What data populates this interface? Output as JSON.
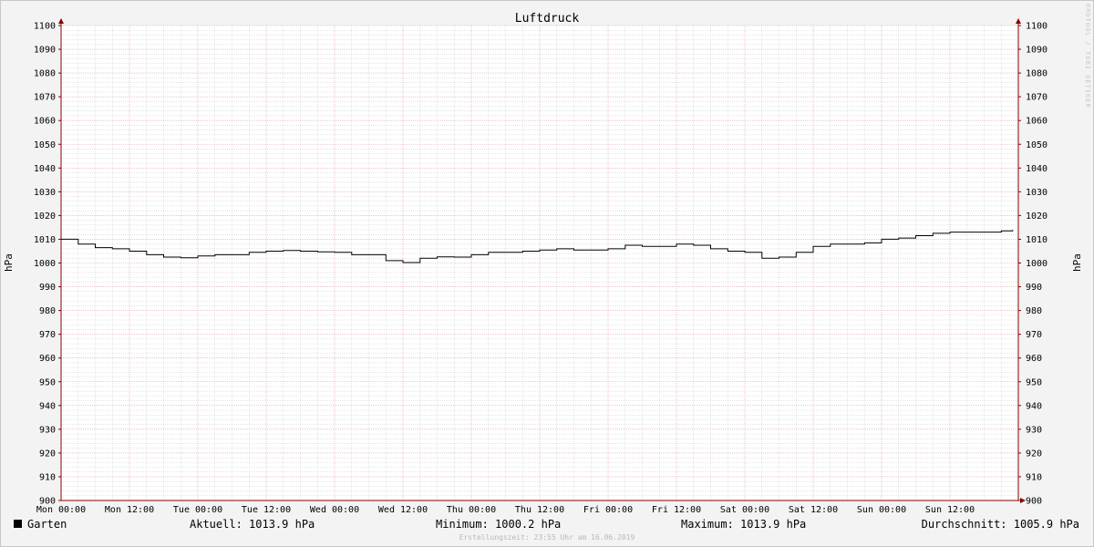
{
  "chart_data": {
    "type": "line",
    "title": "Luftdruck",
    "ylabel": "hPa",
    "ylim": [
      900,
      1100
    ],
    "yticks": [
      900,
      910,
      920,
      930,
      940,
      950,
      960,
      970,
      980,
      990,
      1000,
      1010,
      1020,
      1030,
      1040,
      1050,
      1060,
      1070,
      1080,
      1090,
      1100
    ],
    "x_tick_labels": [
      "Mon 00:00",
      "Mon 12:00",
      "Tue 00:00",
      "Tue 12:00",
      "Wed 00:00",
      "Wed 12:00",
      "Thu 00:00",
      "Thu 12:00",
      "Fri 00:00",
      "Fri 12:00",
      "Sat 00:00",
      "Sat 12:00",
      "Sun 00:00",
      "Sun 12:00"
    ],
    "x_unit": "hours since Mon 00:00",
    "xlim": [
      0,
      168
    ],
    "grid": true,
    "series": [
      {
        "name": "Garten",
        "color": "#000000",
        "x": [
          0,
          3,
          6,
          9,
          12,
          15,
          18,
          21,
          24,
          27,
          30,
          33,
          36,
          39,
          42,
          45,
          48,
          51,
          54,
          57,
          60,
          63,
          66,
          69,
          72,
          75,
          78,
          81,
          84,
          87,
          90,
          93,
          96,
          99,
          102,
          105,
          108,
          111,
          114,
          117,
          120,
          123,
          126,
          129,
          132,
          135,
          138,
          141,
          144,
          147,
          150,
          153,
          156,
          159,
          162,
          165,
          167
        ],
        "values": [
          1010,
          1008,
          1006.5,
          1006,
          1005,
          1003.5,
          1002.5,
          1002.2,
          1003,
          1003.5,
          1003.5,
          1004.5,
          1005,
          1005.3,
          1005,
          1004.7,
          1004.5,
          1003.5,
          1003.5,
          1001,
          1000.2,
          1002,
          1002.6,
          1002.5,
          1003.5,
          1004.5,
          1004.5,
          1005,
          1005.5,
          1006,
          1005.5,
          1005.5,
          1006,
          1007.5,
          1007,
          1007,
          1008,
          1007.5,
          1006,
          1005,
          1004.5,
          1002,
          1002.5,
          1004.5,
          1007,
          1008,
          1008,
          1008.5,
          1010,
          1010.5,
          1011.5,
          1012.5,
          1013,
          1013,
          1013,
          1013.5,
          1013.9
        ]
      }
    ]
  },
  "legend": {
    "series_name": "Garten",
    "swatch_color": "#000000",
    "aktuell": "Aktuell: 1013.9 hPa",
    "minimum": "Minimum: 1000.2 hPa",
    "maximum": "Maximum: 1013.9 hPa",
    "durchschnitt": "Durchschnitt: 1005.9 hPa"
  },
  "footer": "Erstellungszeit: 23:55 Uhr am 16.06.2019",
  "watermark": "RRDTOOL / TOBI OETIKER",
  "colors": {
    "major_grid": "#e0a0a0",
    "minor_grid": "#cccccc",
    "axis": "#8b0000",
    "background": "#f3f3f3",
    "plot_bg": "#ffffff"
  }
}
